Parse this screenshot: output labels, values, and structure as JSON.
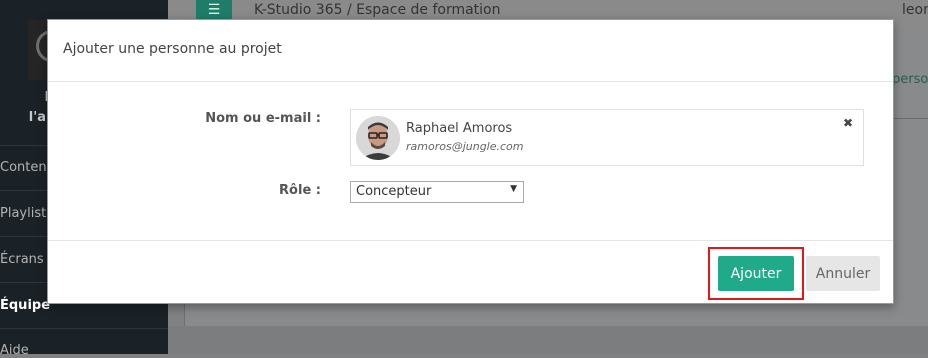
{
  "app": {
    "title": "K-Studio 365 / Espace de formation",
    "user": "leon",
    "menu_icon": "☰",
    "content_link": "perso"
  },
  "sidebar": {
    "title_line1": "Décou",
    "title_line2": "l'applica",
    "items": [
      {
        "label": "Contenu"
      },
      {
        "label": "Playlists"
      },
      {
        "label": "Écrans c"
      },
      {
        "label": "Équipe"
      },
      {
        "label": "Aide"
      }
    ]
  },
  "modal": {
    "title": "Ajouter une personne au projet",
    "name_label": "Nom ou e-mail :",
    "role_label": "Rôle :",
    "person": {
      "name": "Raphael Amoros",
      "email": "ramoros@jungle.com",
      "remove_icon": "✖"
    },
    "role": {
      "value": "Concepteur",
      "arrow": "▼"
    },
    "buttons": {
      "add": "Ajouter",
      "cancel": "Annuler"
    }
  },
  "colors": {
    "primary": "#1fab89",
    "highlight": "#e01818",
    "overlay": "#7f8183"
  }
}
